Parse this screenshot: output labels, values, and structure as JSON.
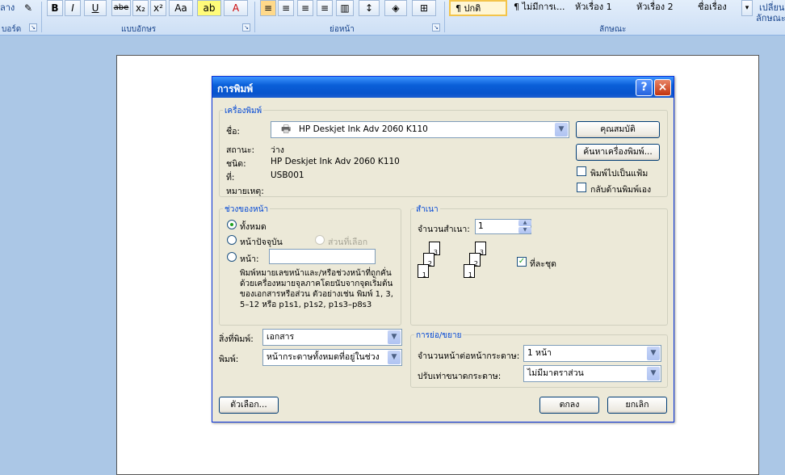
{
  "ribbon": {
    "clipboard_label": "บอร์ด",
    "clipboard_top_text": "ลาง",
    "font_group_label": "แบบอักษร",
    "paragraph_group_label": "ย่อหน้า",
    "styles_group_label": "ลักษณะ",
    "font_buttons": [
      "B",
      "I",
      "U",
      "abe",
      "x₂",
      "x²",
      "Aa"
    ],
    "styles": [
      "¶ ปกติ",
      "¶ ไม่มีการเ...",
      "หัวเรื่อง 1",
      "หัวเรื่อง 2",
      "ชื่อเรื่อง"
    ],
    "change_styles": [
      "เปลี่ยน",
      "ลักษณะ"
    ]
  },
  "dialog": {
    "title": "การพิมพ์",
    "help": "?",
    "close": "×",
    "printer": {
      "legend": "เครื่องพิมพ์",
      "name_label": "ชื่อ:",
      "name_value": "HP Deskjet Ink Adv 2060 K110",
      "status_label": "สถานะ:",
      "status_value": "ว่าง",
      "type_label": "ชนิด:",
      "type_value": "HP Deskjet Ink Adv 2060 K110",
      "where_label": "ที่:",
      "where_value": "USB001",
      "comment_label": "หมายเหตุ:",
      "properties_button": "คุณสมบัติ",
      "find_printer_button": "ค้นหาเครื่องพิมพ์...",
      "print_to_file": "พิมพ์ไปเป็นแฟ้ม",
      "manual_duplex": "กลับด้านพิมพ์เอง"
    },
    "page_range": {
      "legend": "ช่วงของหน้า",
      "all": "ทั้งหมด",
      "current_page": "หน้าปัจจุบัน",
      "selection": "ส่วนที่เลือก",
      "pages": "หน้า:",
      "pages_value": "",
      "note": "พิมพ์หมายเลขหน้าและ/หรือช่วงหน้าที่ถูกคั่นด้วยเครื่องหมายจุลภาคโดยนับจากจุดเริ่มต้นของเอกสารหรือส่วน ตัวอย่างเช่น พิมพ์ 1, 3, 5–12 หรือ p1s1, p1s2, p1s3–p8s3"
    },
    "copies": {
      "legend": "สำเนา",
      "count_label": "จำนวนสำเนา:",
      "count_value": "1",
      "collate": "ที่ละชุด"
    },
    "print_what_label": "สิ่งที่พิมพ์:",
    "print_what_value": "เอกสาร",
    "print_label": "พิมพ์:",
    "print_value": "หน้ากระดาษทั้งหมดที่อยู่ในช่วง",
    "zoom": {
      "legend": "การย่อ/ขยาย",
      "pages_per_sheet_label": "จำนวนหน้าต่อหน้ากระดาษ:",
      "pages_per_sheet_value": "1 หน้า",
      "scale_label": "ปรับเท่าขนาดกระดาษ:",
      "scale_value": "ไม่มีมาตราส่วน"
    },
    "options_button": "ตัวเลือก...",
    "ok_button": "ตกลง",
    "cancel_button": "ยกเลิก"
  }
}
